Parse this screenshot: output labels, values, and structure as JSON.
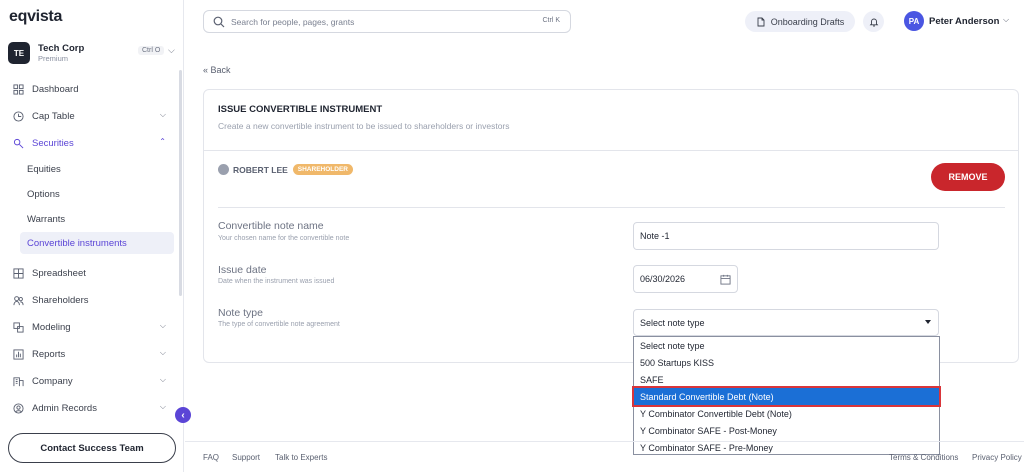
{
  "app": {
    "logo": "eqvista"
  },
  "org": {
    "initials": "TE",
    "name": "Tech Corp",
    "plan": "Premium",
    "shortcut": "Ctrl O"
  },
  "sidebar": {
    "items": [
      {
        "label": "Dashboard",
        "icon": "dashboard-icon"
      },
      {
        "label": "Cap Table",
        "icon": "cap-table-icon"
      },
      {
        "label": "Securities",
        "icon": "securities-icon"
      },
      {
        "label": "Equities"
      },
      {
        "label": "Options"
      },
      {
        "label": "Warrants"
      },
      {
        "label": "Convertible instruments"
      },
      {
        "label": "Spreadsheet",
        "icon": "spreadsheet-icon"
      },
      {
        "label": "Shareholders",
        "icon": "shareholders-icon"
      },
      {
        "label": "Modeling",
        "icon": "modeling-icon"
      },
      {
        "label": "Reports",
        "icon": "reports-icon"
      },
      {
        "label": "Company",
        "icon": "company-icon"
      },
      {
        "label": "Admin Records",
        "icon": "admin-records-icon"
      }
    ],
    "contact_label": "Contact Success Team"
  },
  "topbar": {
    "search_placeholder": "Search for people, pages, grants",
    "search_shortcut": "Ctrl K",
    "drafts_label": "Onboarding Drafts",
    "user_initials": "PA",
    "user_name": "Peter Anderson"
  },
  "main": {
    "back_label": "« Back",
    "title": "ISSUE CONVERTIBLE INSTRUMENT",
    "subtitle": "Create a new convertible instrument to be issued to shareholders or investors",
    "holder_name": "ROBERT LEE",
    "holder_badge": "SHAREHOLDER",
    "remove_label": "REMOVE",
    "fields": {
      "name": {
        "label": "Convertible note name",
        "help": "Your chosen name for the convertible note",
        "value": "Note -1"
      },
      "date": {
        "label": "Issue date",
        "help": "Date when the instrument was issued",
        "value": "06/30/2026"
      },
      "type": {
        "label": "Note type",
        "help": "The type of convertible note agreement",
        "value": "Select note type"
      }
    },
    "note_type_options": [
      "Select note type",
      "500 Startups KISS",
      "SAFE",
      "Standard Convertible Debt (Note)",
      "Y Combinator Convertible Debt (Note)",
      "Y Combinator SAFE - Post-Money",
      "Y Combinator SAFE - Pre-Money"
    ]
  },
  "footer": {
    "faq": "FAQ",
    "support": "Support",
    "experts": "Talk to Experts",
    "terms": "Terms & Conditions",
    "privacy": "Privacy Policy"
  },
  "colors": {
    "accent": "#5b45d6",
    "danger": "#c9262c",
    "highlight": "#1b6fd6",
    "badge": "#f0b86a"
  }
}
